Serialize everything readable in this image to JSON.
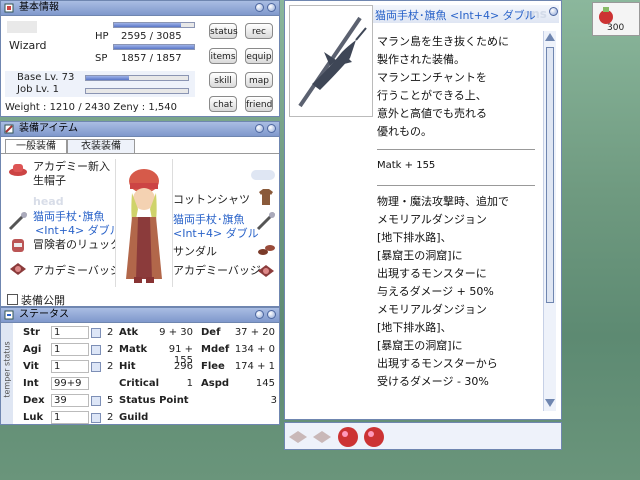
{
  "basic_info": {
    "title": "基本情報",
    "job": "Wizard",
    "hp_label": "HP",
    "hp_value": "2595 / 3085",
    "hp_fraction": 0.84,
    "sp_label": "SP",
    "sp_value": "1857 / 1857",
    "sp_fraction": 1.0,
    "base_lv": "Base Lv. 73",
    "base_fraction": 0.42,
    "job_lv": "Job Lv. 1",
    "job_fraction": 0.0,
    "weight_zeny": "Weight : 1210 / 2430 Zeny : 1,540",
    "buttons": [
      "status",
      "rec",
      "items",
      "equip",
      "skill",
      "map",
      "chat",
      "friend"
    ]
  },
  "equipment": {
    "title": "装備アイテム",
    "tabs": [
      "一般装備",
      "衣装装備"
    ],
    "left_items": [
      "アカデミー新入",
      "生帽子",
      "猫両手杖･旗魚",
      "<Int+4> ダブル",
      "冒険者のリュック",
      "アカデミーバッジ"
    ],
    "right_items": [
      "コットンシャツ",
      "猫両手杖･旗魚",
      "<Int+4> ダブル",
      "サンダル",
      "アカデミーバッジ"
    ],
    "ghost_head": "head",
    "public_label": "装備公開"
  },
  "status": {
    "title": "ステータス",
    "side_label": "temper status",
    "stats": [
      {
        "name": "Str",
        "val": "1",
        "cost": "2"
      },
      {
        "name": "Agi",
        "val": "1",
        "cost": "2"
      },
      {
        "name": "Vit",
        "val": "1",
        "cost": "2"
      },
      {
        "name": "Int",
        "val": "99+9",
        "cost": ""
      },
      {
        "name": "Dex",
        "val": "39",
        "cost": "5"
      },
      {
        "name": "Luk",
        "val": "1",
        "cost": "2"
      }
    ],
    "left2": [
      {
        "name": "Atk",
        "val": "9 + 30"
      },
      {
        "name": "Matk",
        "val": "91 + 155"
      },
      {
        "name": "Hit",
        "val": "296"
      },
      {
        "name": "Critical",
        "val": "1"
      },
      {
        "name": "Status Point",
        "val": "3"
      },
      {
        "name": "Guild",
        "val": ""
      }
    ],
    "right2": [
      {
        "name": "Def",
        "val": "37 + 20"
      },
      {
        "name": "Mdef",
        "val": "134 + 0"
      },
      {
        "name": "Flee",
        "val": "174 + 1"
      },
      {
        "name": "Aspd",
        "val": "145"
      }
    ]
  },
  "item_desc": {
    "title": "猫両手杖･旗魚 <Int+4> ダブル",
    "watermark": "ons",
    "lines_top": [
      "マラン島を生き抜くために",
      "製作された装備。",
      "マランエンチャントを",
      "行うことができる上、",
      "意外と高値でも売れる",
      "優れもの。"
    ],
    "matk": "Matk + 155",
    "lines_bottom": [
      "物理・魔法攻撃時、追加で",
      "メモリアルダンジョン",
      "[地下排水路]、",
      "[暴窟王の洞窟]に",
      "出現するモンスターに",
      "与えるダメージ + 50%",
      "メモリアルダンジョン",
      "[地下排水路]、",
      "[暴窟王の洞窟]に",
      "出現するモンスターから",
      "受けるダメージ - 30%"
    ]
  },
  "corner": {
    "value": "300"
  }
}
